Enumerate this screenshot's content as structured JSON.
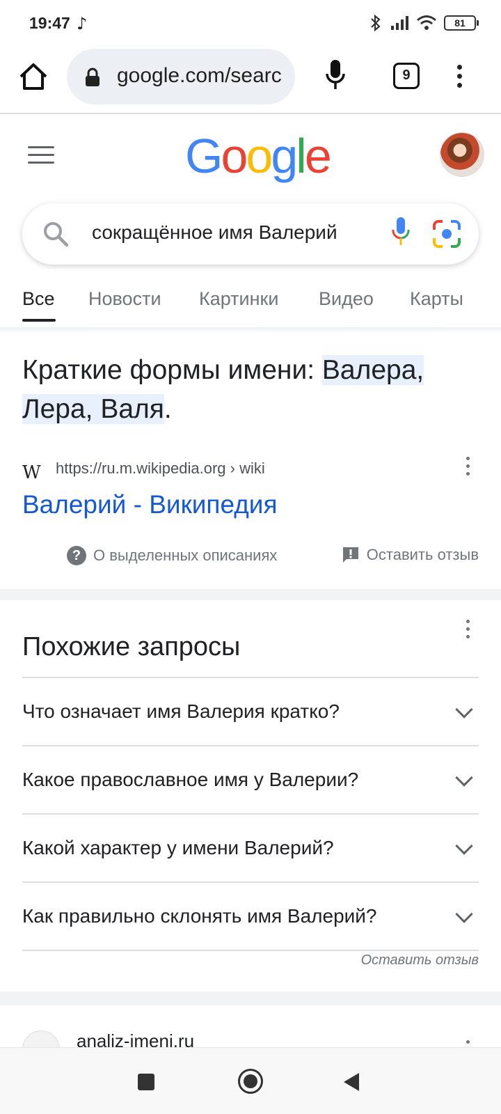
{
  "status_bar": {
    "time": "19:47",
    "battery": "81",
    "icons": [
      "tiktok-icon",
      "bluetooth-icon",
      "signal-icon",
      "wifi-icon",
      "battery-icon"
    ]
  },
  "browser": {
    "url": "google.com/search",
    "tab_count": "9"
  },
  "google": {
    "logo": "Google",
    "logo_colors": [
      "#4285F4",
      "#EA4335",
      "#FBBC05",
      "#4285F4",
      "#34A853",
      "#EA4335"
    ]
  },
  "search": {
    "query": "сокращённое имя Валерий"
  },
  "tabs": [
    {
      "label": "Все",
      "active": true
    },
    {
      "label": "Новости"
    },
    {
      "label": "Картинки"
    },
    {
      "label": "Видео"
    },
    {
      "label": "Карты"
    }
  ],
  "snippet": {
    "answer_prefix": "Краткие формы имени: ",
    "answer_highlight_1": "Валера,",
    "answer_highlight_2": "Лера, Валя",
    "answer_suffix": ".",
    "source_icon": "W",
    "source_url": "https://ru.m.wikipedia.org › wiki",
    "result_title": "Валерий - Википедия",
    "about_label": "О выделенных описаниях",
    "feedback_label": "Оставить отзыв"
  },
  "related": {
    "title": "Похожие запросы",
    "questions": [
      "Что означает имя Валерия кратко?",
      "Какое православное имя у Валерии?",
      "Какой характер у имени Валерий?",
      "Как правильно склонять имя Валерий?"
    ],
    "feedback_label": "Оставить отзыв"
  },
  "next_result": {
    "domain": "analiz-imeni.ru"
  },
  "colors": {
    "link": "#1558d6",
    "highlight": "#e8f0fe",
    "muted": "#70757a"
  }
}
